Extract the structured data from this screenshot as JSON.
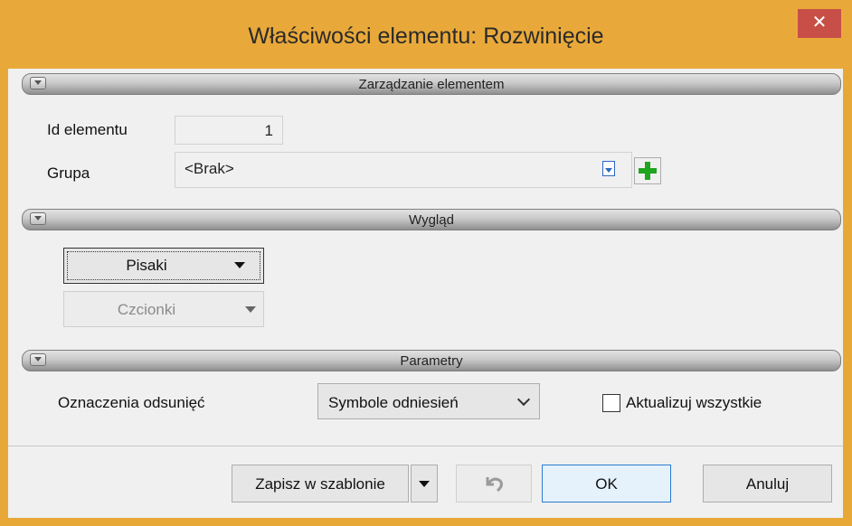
{
  "window": {
    "title": "Właściwości elementu: Rozwinięcie",
    "close_glyph": "✕"
  },
  "sections": {
    "management": {
      "title": "Zarządzanie elementem"
    },
    "appearance": {
      "title": "Wygląd"
    },
    "parameters": {
      "title": "Parametry"
    }
  },
  "management": {
    "id_label": "Id elementu",
    "id_value": "1",
    "group_label": "Grupa",
    "group_value": "<Brak>"
  },
  "appearance": {
    "pens_label": "Pisaki",
    "fonts_label": "Czcionki"
  },
  "parameters": {
    "offset_label": "Oznaczenia odsunięć",
    "offset_selected": "Symbole odniesień",
    "update_all_label": "Aktualizuj wszystkie",
    "update_all_checked": false
  },
  "footer": {
    "save_template_label": "Zapisz w szablonie",
    "ok_label": "OK",
    "cancel_label": "Anuluj"
  },
  "icons": {
    "group_browse": "document-icon",
    "group_add": "green-plus-icon",
    "undo": "undo-icon"
  },
  "colors": {
    "titlebar": "#e9a93a",
    "close": "#c74f48",
    "plus": "#1fa51f"
  }
}
